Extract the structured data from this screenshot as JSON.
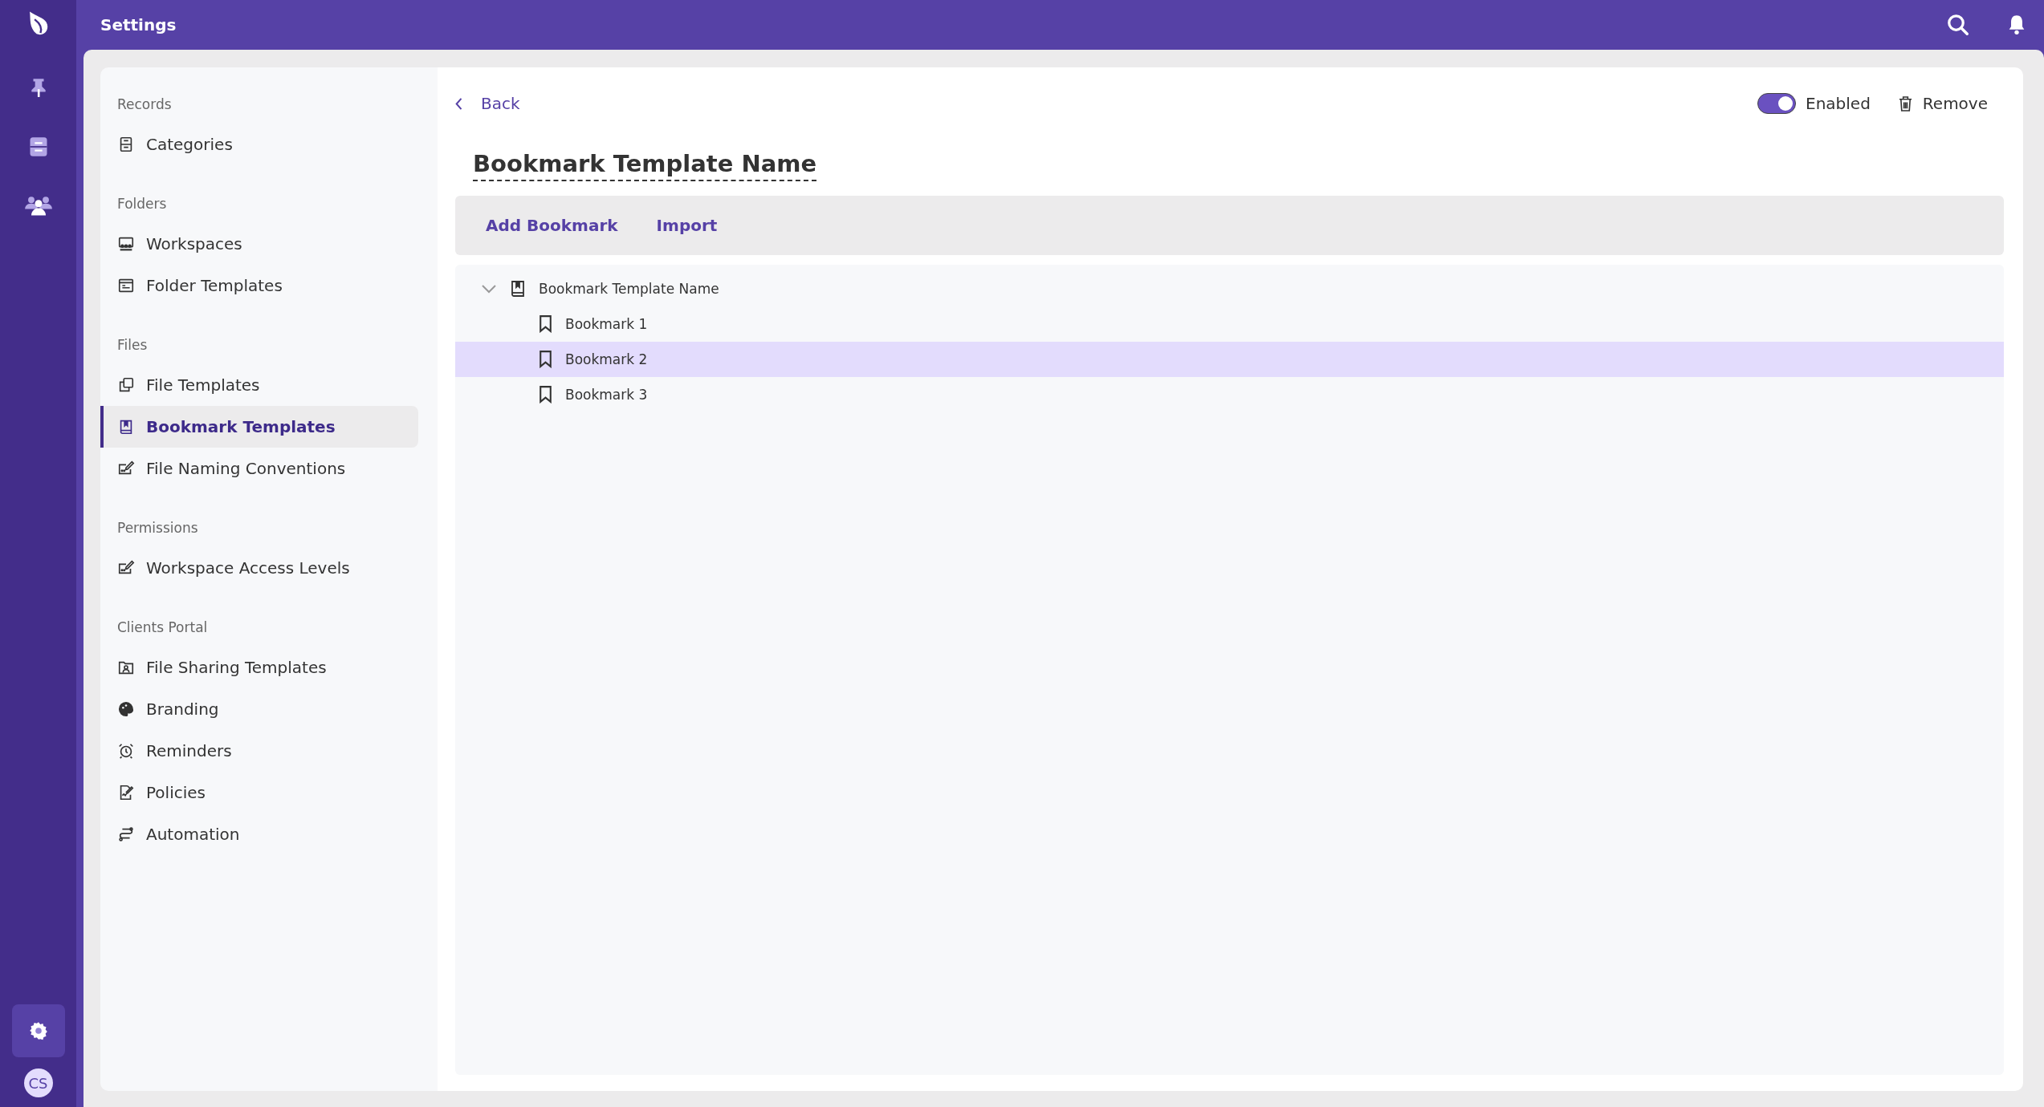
{
  "header": {
    "title": "Settings"
  },
  "rail": {
    "items": [
      {
        "selected": false
      },
      {
        "selected": false
      },
      {
        "selected": false
      }
    ],
    "settings_selected": true,
    "avatar": "CS"
  },
  "sidebar": {
    "sections": [
      {
        "heading": "Records",
        "items": [
          {
            "label": "Categories",
            "selected": false
          }
        ]
      },
      {
        "heading": "Folders",
        "items": [
          {
            "label": "Workspaces",
            "selected": false
          },
          {
            "label": "Folder Templates",
            "selected": false
          }
        ]
      },
      {
        "heading": "Files",
        "items": [
          {
            "label": "File Templates",
            "selected": false
          },
          {
            "label": "Bookmark Templates",
            "selected": true
          },
          {
            "label": "File Naming Conventions",
            "selected": false
          }
        ]
      },
      {
        "heading": "Permissions",
        "items": [
          {
            "label": "Workspace Access Levels",
            "selected": false
          }
        ]
      },
      {
        "heading": "Clients Portal",
        "items": [
          {
            "label": "File Sharing Templates",
            "selected": false
          },
          {
            "label": "Branding",
            "selected": false
          },
          {
            "label": "Reminders",
            "selected": false
          },
          {
            "label": "Policies",
            "selected": false
          },
          {
            "label": "Automation",
            "selected": false
          }
        ]
      }
    ]
  },
  "detail": {
    "back": "Back",
    "toggle": {
      "label": "Enabled",
      "on": true
    },
    "remove": "Remove",
    "title": "Bookmark Template Name",
    "toolbar": [
      "Add Bookmark",
      "Import"
    ],
    "tree": {
      "label": "Bookmark Template Name",
      "expanded": true,
      "selected": false,
      "children": [
        {
          "label": "Bookmark 1",
          "selected": false
        },
        {
          "label": "Bookmark 2",
          "selected": true
        },
        {
          "label": "Bookmark 3",
          "selected": false
        }
      ]
    }
  }
}
